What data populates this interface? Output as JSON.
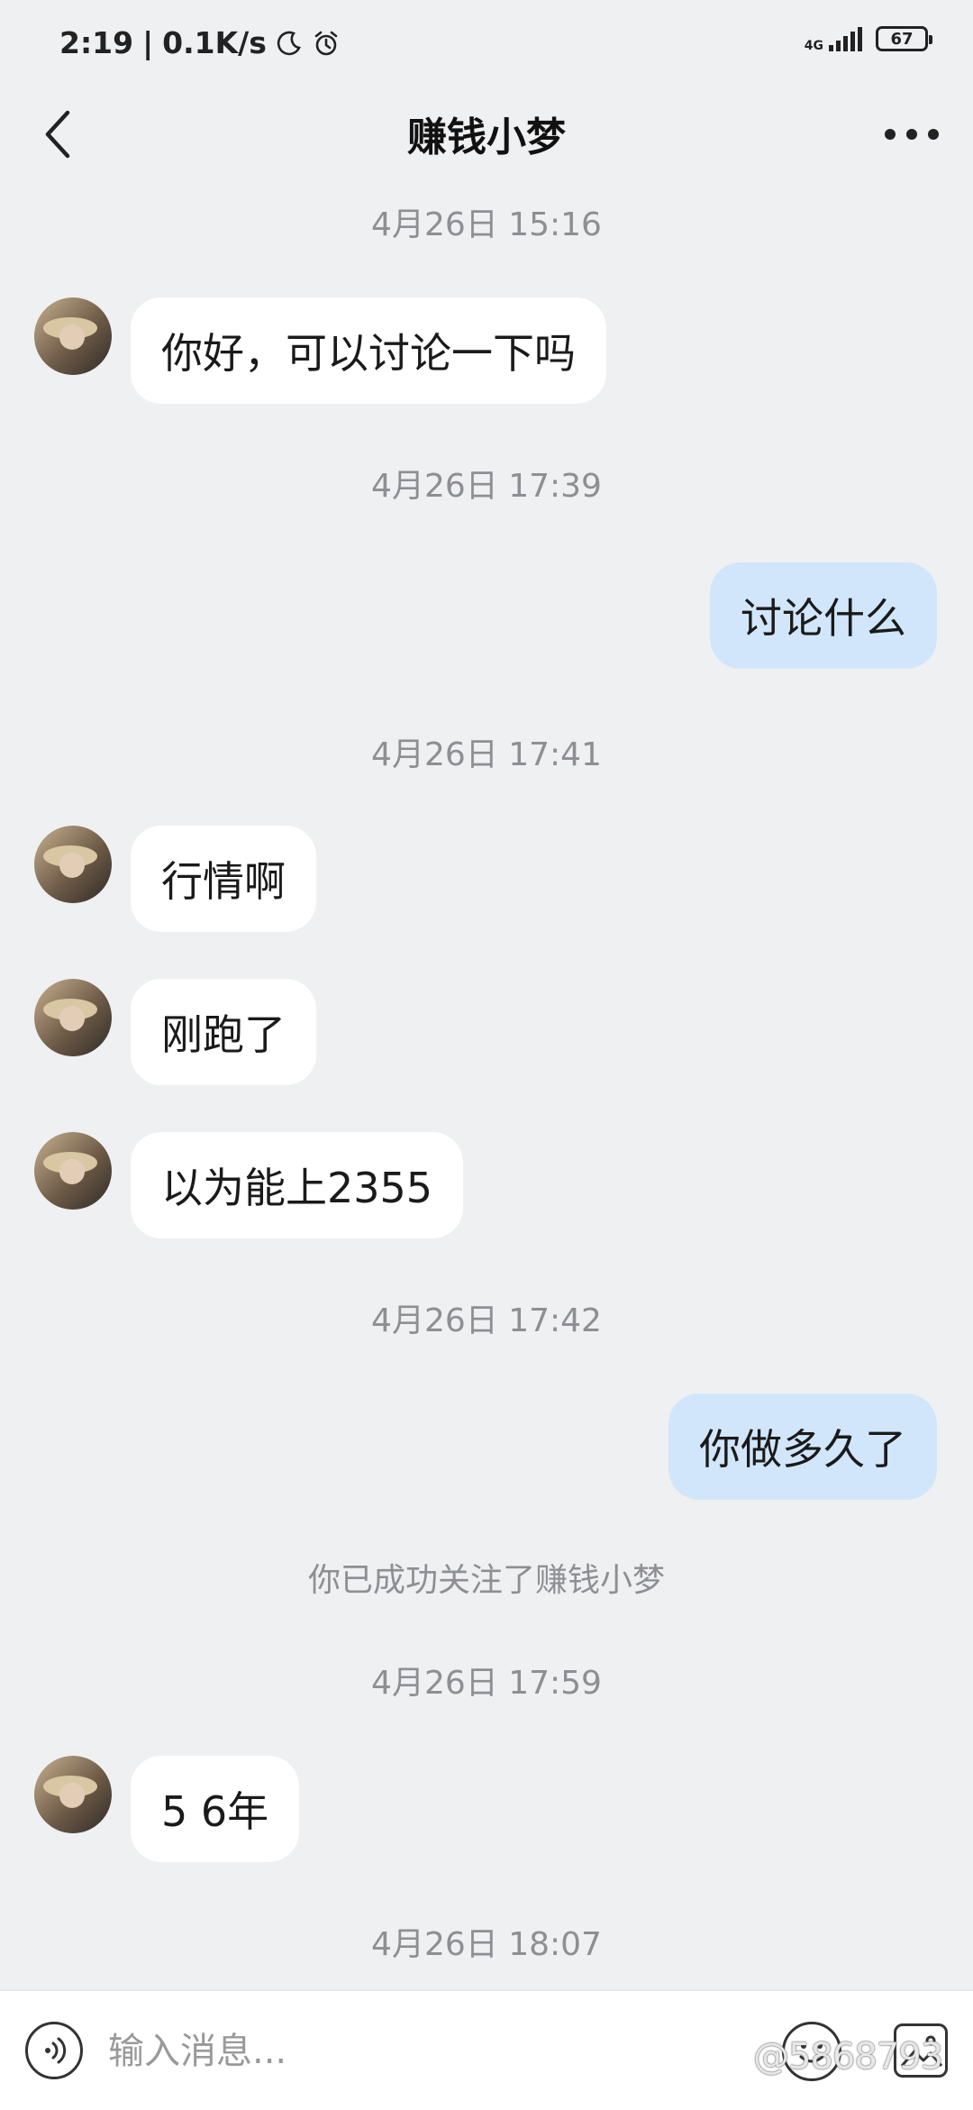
{
  "status_bar": {
    "time": "2:19",
    "separator": "|",
    "net_speed": "0.1K/s",
    "network": "4G",
    "battery": "67",
    "icons": [
      "moon-icon",
      "alarm-icon",
      "signal-icon",
      "battery-icon"
    ]
  },
  "header": {
    "title": "赚钱小梦",
    "icons": [
      "chevron-left-icon",
      "more-dots-icon"
    ]
  },
  "messages": [
    {
      "type": "time",
      "text": "4月26日 15:16"
    },
    {
      "type": "in",
      "text": "你好，可以讨论一下吗"
    },
    {
      "type": "time",
      "text": "4月26日 17:39"
    },
    {
      "type": "out",
      "text": "讨论什么"
    },
    {
      "type": "time",
      "text": "4月26日 17:41"
    },
    {
      "type": "in",
      "text": "行情啊"
    },
    {
      "type": "in",
      "text": "刚跑了"
    },
    {
      "type": "in",
      "text": "以为能上2355"
    },
    {
      "type": "time",
      "text": "4月26日 17:42"
    },
    {
      "type": "out",
      "text": "你做多久了"
    },
    {
      "type": "notice",
      "text": "你已成功关注了赚钱小梦"
    },
    {
      "type": "time",
      "text": "4月26日 17:59"
    },
    {
      "type": "in",
      "text": "5 6年"
    },
    {
      "type": "time",
      "text": "4月26日 18:07"
    }
  ],
  "input_bar": {
    "placeholder": "输入消息...",
    "watermark": "@5868793",
    "icons": [
      "voice-icon",
      "emoji-icon",
      "image-icon"
    ]
  },
  "colors": {
    "background": "#eff0f2",
    "incoming_bubble": "#ffffff",
    "outgoing_bubble": "#d2e6fb",
    "timestamp": "#8e8e93"
  }
}
